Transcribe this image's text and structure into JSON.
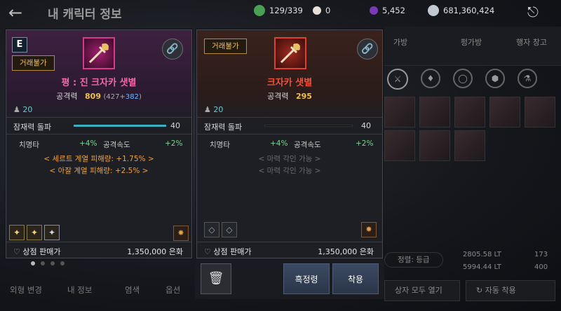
{
  "header": {
    "title": "내 캐릭터 정보",
    "resources": [
      {
        "name": "inventory",
        "value": "129/339",
        "color": "#4aa052",
        "icon": "bag-icon"
      },
      {
        "name": "pearl",
        "value": "0",
        "color": "#e8e0d8",
        "icon": "pearl-icon"
      },
      {
        "name": "crystal",
        "value": "5,452",
        "color": "#7a3ab8",
        "icon": "crystal-icon"
      },
      {
        "name": "silver",
        "value": "681,360,424",
        "color": "#c0c8d0",
        "icon": "silver-icon"
      }
    ]
  },
  "bg_tabs": {
    "bag": "가방",
    "warehouse": "펑가방",
    "other": "행자 창고"
  },
  "card_left": {
    "grade": "E",
    "trade_tag": "거래불가",
    "item_name": "평 : 진 크자카 샛별",
    "attack_label": "공격력",
    "attack_value": "809",
    "attack_detail_open": "(427+",
    "attack_detail_bonus": "382",
    "attack_detail_close": ")",
    "level": "20",
    "potential_label": "잠재력 돌파",
    "potential_value": "40",
    "crit_label": "치명타",
    "crit_value": "+4%",
    "aspd_label": "공격속도",
    "aspd_value": "+2%",
    "set_bonus_1": "< 세르트 계열 피해량: +1.75% >",
    "set_bonus_2": "< 아잘 계열 피해량: +2.5% >",
    "sell_label": "상점 판매가",
    "sell_value": "1,350,000 은화"
  },
  "card_right": {
    "trade_tag": "거래불가",
    "item_name": "크자카 샛별",
    "attack_label": "공격력",
    "attack_value": "295",
    "level": "20",
    "potential_label": "잠재력 돌파",
    "potential_value": "40",
    "crit_label": "치명타",
    "crit_value": "+4%",
    "aspd_label": "공격속도",
    "aspd_value": "+2%",
    "engrave_1": "< 마력 각인 가능 >",
    "engrave_2": "< 마력 각인 가능 >",
    "sell_label": "상점 판매가",
    "sell_value": "1,350,000 은화"
  },
  "actions": {
    "black_spirit": "흑정령",
    "equip": "착용"
  },
  "bottom": {
    "tabs": [
      "외형 변경",
      "내 정보",
      "염색",
      "옵션"
    ],
    "sort_label": "정렬: 등급",
    "weight_1": "2805.58 LT",
    "weight_2": "5994.44 LT",
    "slots_1": "173",
    "slots_2": "400",
    "open_all": "상자 모두 열기",
    "auto_equip": "자동 착용"
  }
}
